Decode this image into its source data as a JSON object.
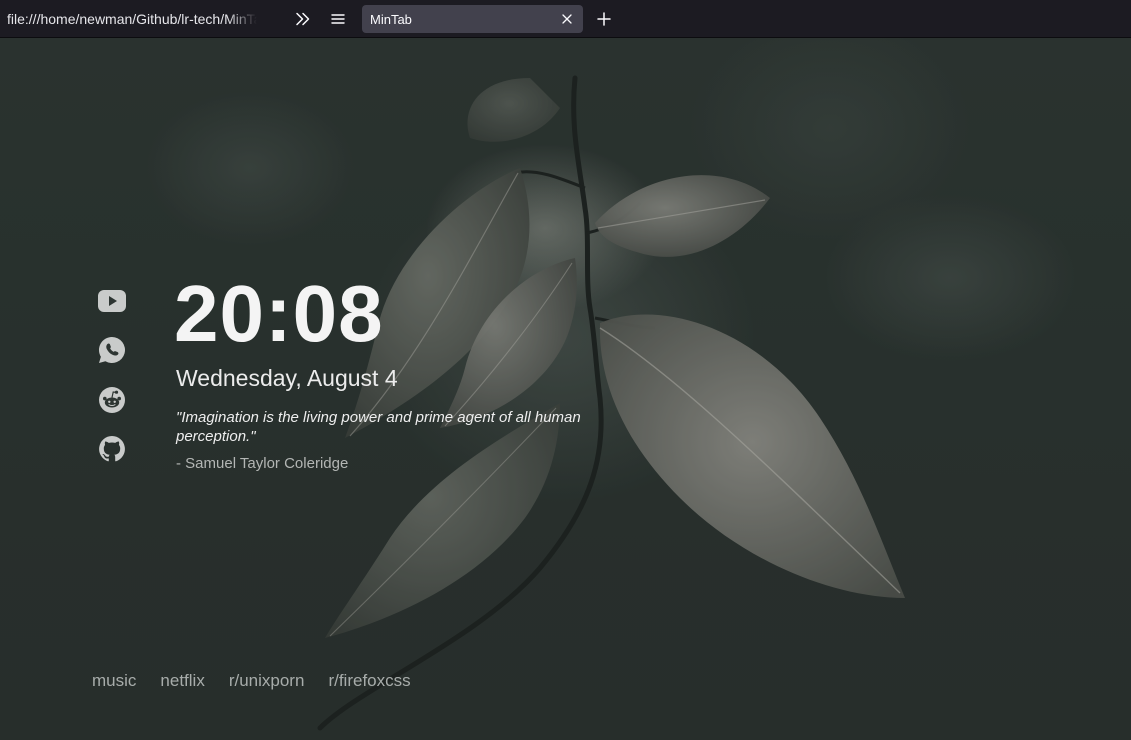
{
  "browser": {
    "url": "file:///home/newman/Github/lr-tech/MinTab/index.html",
    "tab": {
      "title": "MinTab"
    }
  },
  "page": {
    "clock": "20:08",
    "date": "Wednesday, August 4",
    "quote": {
      "text": "\"Imagination is the living power and prime agent of all human perception.\"",
      "author": "- Samuel Taylor Coleridge"
    },
    "social": [
      {
        "icon": "youtube-icon"
      },
      {
        "icon": "whatsapp-icon"
      },
      {
        "icon": "reddit-icon"
      },
      {
        "icon": "github-icon"
      }
    ],
    "links": [
      {
        "label": "music"
      },
      {
        "label": "netflix"
      },
      {
        "label": "r/unixporn"
      },
      {
        "label": "r/firefoxcss"
      }
    ],
    "colors": {
      "toolbar": "#1c1b22",
      "tab": "#42414d",
      "background": "#2b3431",
      "icon": "#c9cbca"
    }
  }
}
